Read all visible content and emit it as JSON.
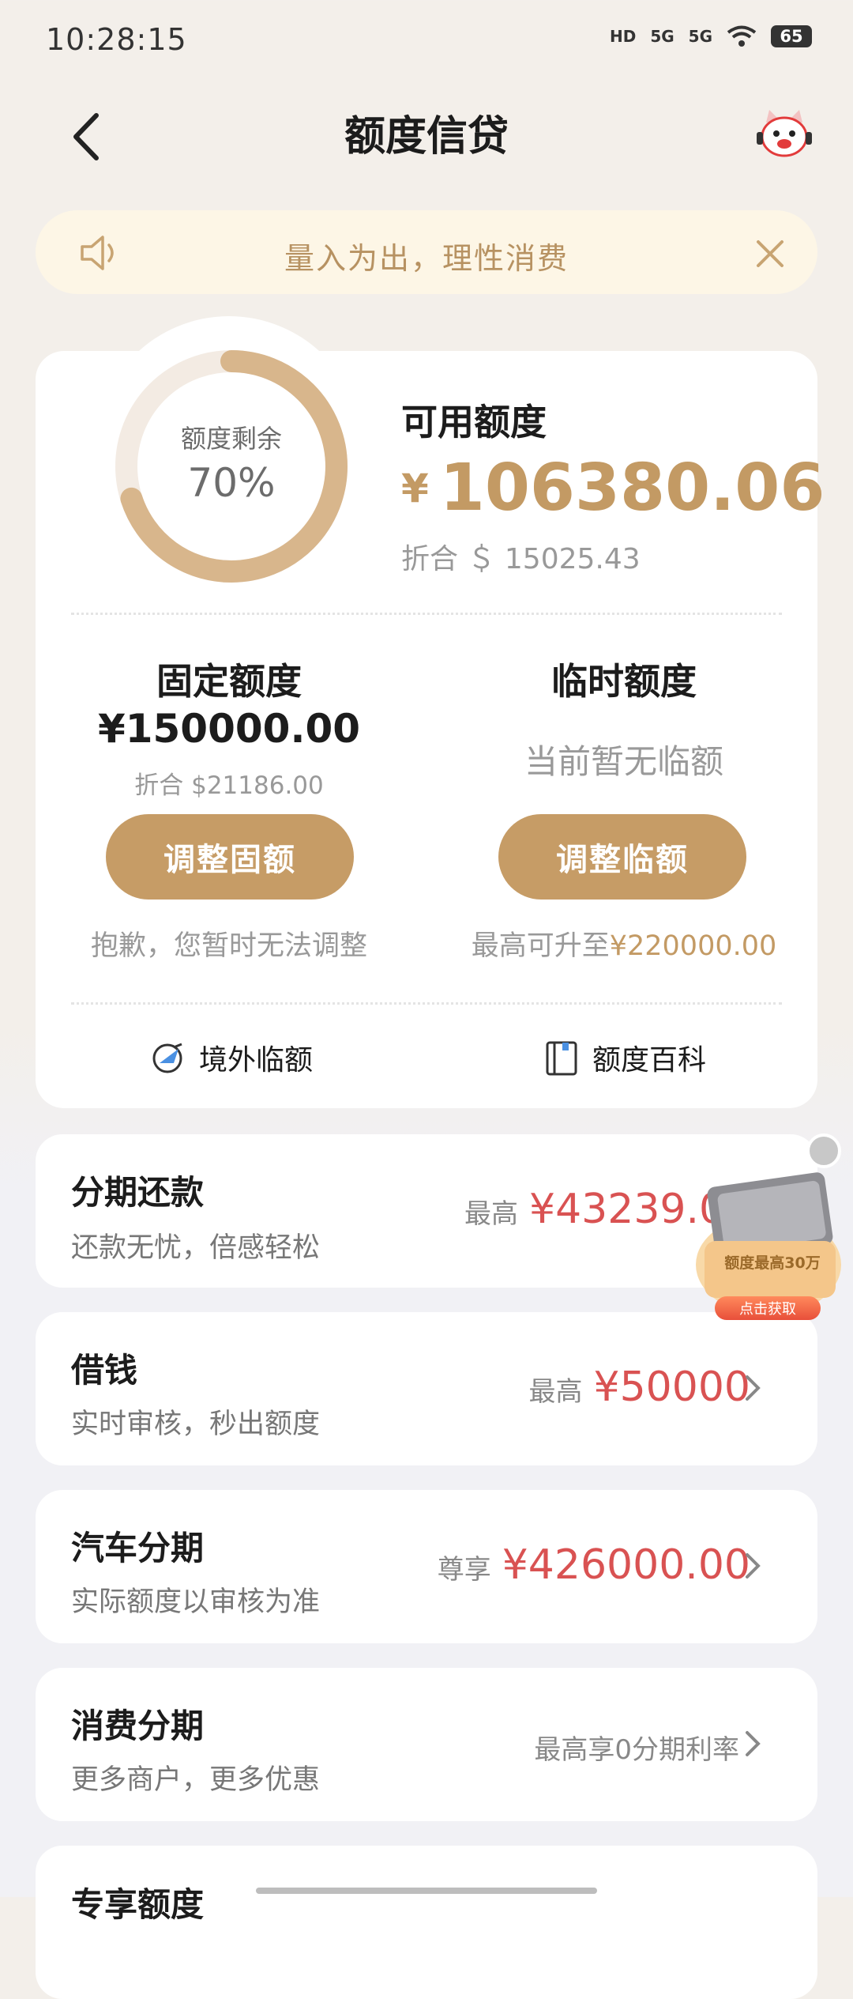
{
  "status_bar": {
    "time": "10:28:15",
    "hd": "HD",
    "signal1": "5G",
    "signal2": "5G",
    "battery": "65"
  },
  "header": {
    "title": "额度信贷"
  },
  "banner": {
    "text": "量入为出，理性消费"
  },
  "quota": {
    "ring_label": "额度剩余",
    "ring_percent": "70%",
    "remaining_fraction": 0.7,
    "available_label": "可用额度",
    "currency": "¥",
    "available_amount": "106380.06",
    "available_conv": "折合 ＄ 15025.43",
    "fixed": {
      "title": "固定额度",
      "amount": "¥150000.00",
      "conv": "折合 $21186.00",
      "button": "调整固额",
      "note": "抱歉，您暂时无法调整"
    },
    "temporary": {
      "title": "临时额度",
      "status": "当前暂无临额",
      "button": "调整临额",
      "note_prefix": "最高可升至",
      "note_amount": "¥220000.00"
    },
    "links": {
      "overseas": "境外临额",
      "wiki": "额度百科"
    }
  },
  "products": [
    {
      "title": "分期还款",
      "subtitle": "还款无忧，倍感轻松",
      "prefix": "最高",
      "value": "¥43239.00"
    },
    {
      "title": "借钱",
      "subtitle": "实时审核，秒出额度",
      "prefix": "最高",
      "value": "¥50000"
    },
    {
      "title": "汽车分期",
      "subtitle": "实际额度以审核为准",
      "prefix": "尊享",
      "value": "¥426000.00"
    },
    {
      "title": "消费分期",
      "subtitle": "更多商户，更多优惠",
      "prefix": "最高享0分期利率",
      "value": ""
    },
    {
      "title": "专享额度"
    }
  ],
  "promo": {
    "caption": "额度最高30万",
    "button": "点击获取"
  },
  "colors": {
    "gold": "#c69c66",
    "red": "#d95252",
    "banner_bg": "#fdf6e6"
  }
}
